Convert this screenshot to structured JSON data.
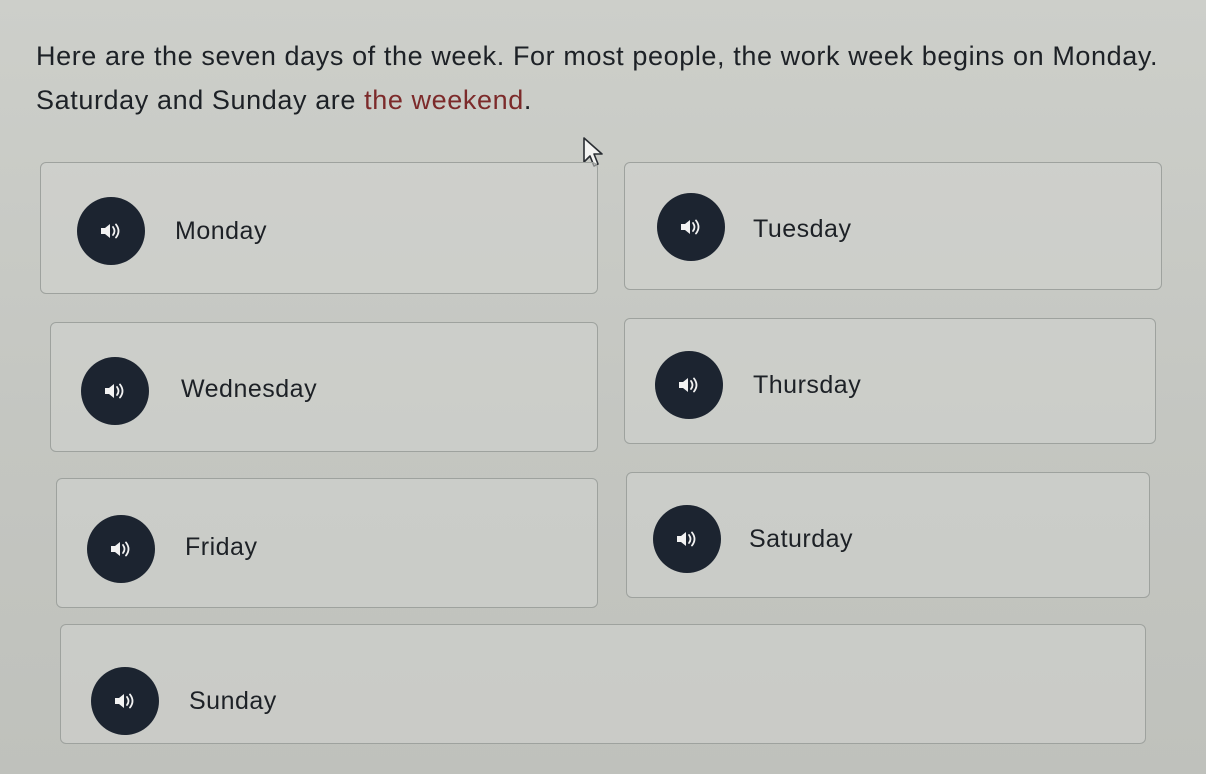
{
  "intro": {
    "text_before": "Here are the seven days of the week. For most people, the work week begins on Monday. Saturday and Sunday are ",
    "highlight": "the weekend",
    "text_after": "."
  },
  "days": [
    {
      "label": "Monday"
    },
    {
      "label": "Tuesday"
    },
    {
      "label": "Wednesday"
    },
    {
      "label": "Thursday"
    },
    {
      "label": "Friday"
    },
    {
      "label": "Saturday"
    },
    {
      "label": "Sunday"
    }
  ],
  "icons": {
    "audio": "speaker-icon",
    "pointer": "mouse-pointer-icon"
  },
  "colors": {
    "highlight": "#7c2a2a",
    "audio_button": "#1c2430"
  }
}
